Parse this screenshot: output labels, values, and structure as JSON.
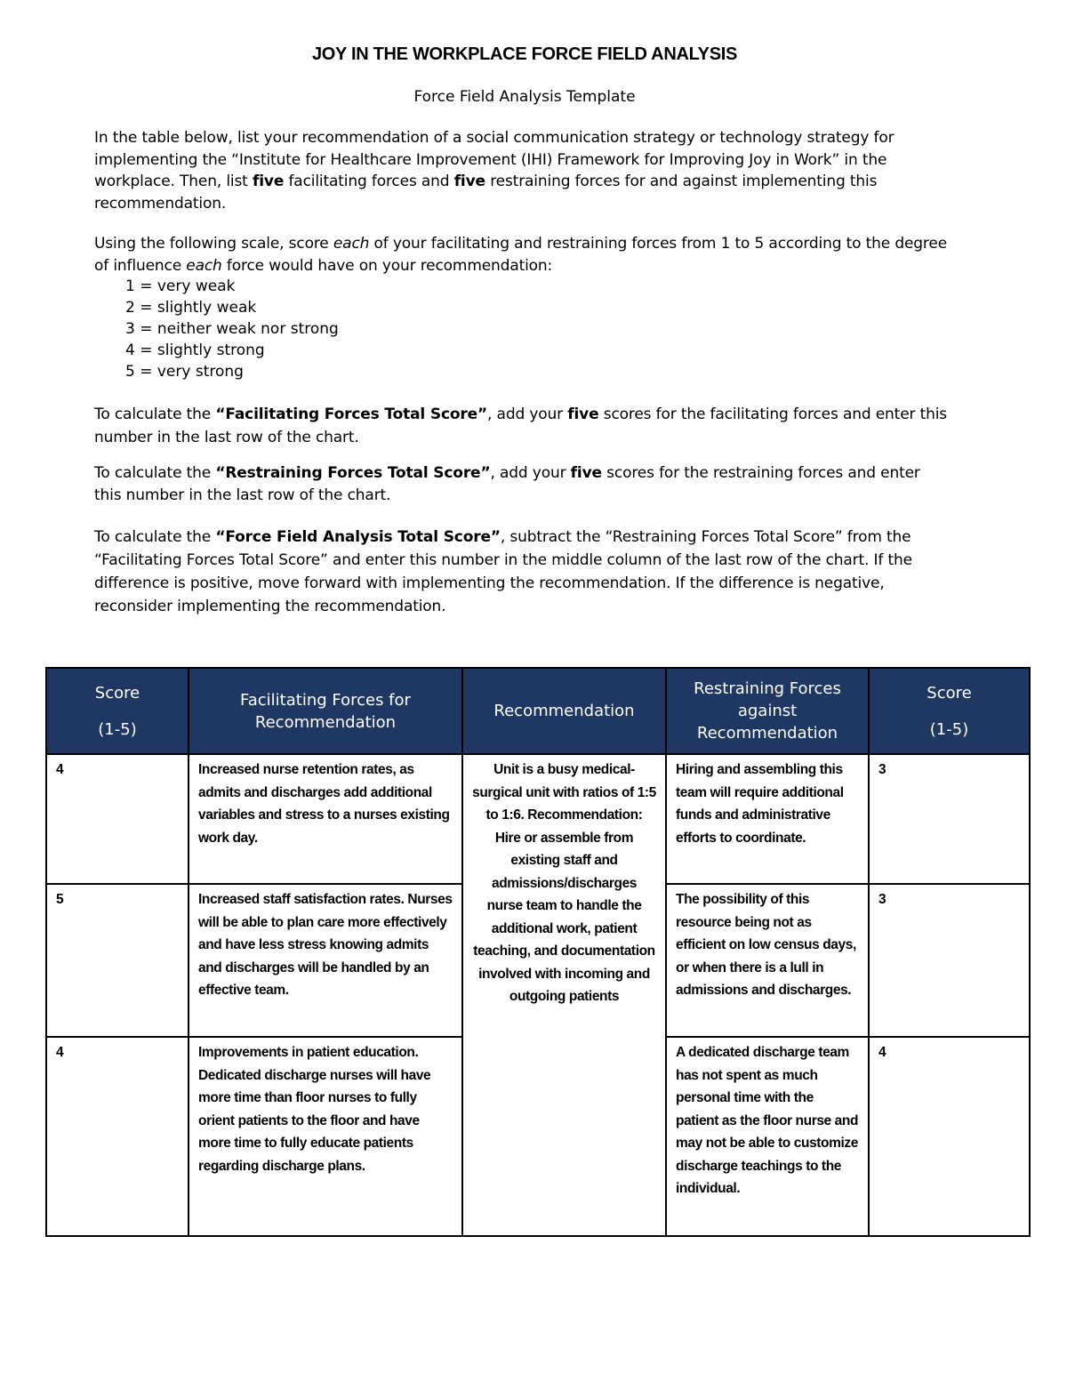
{
  "document": {
    "title": "JOY IN THE WORKPLACE FORCE FIELD ANALYSIS",
    "subtitle": "Force Field Analysis Template",
    "intro": {
      "part1": "In the table below, list your recommendation of a social communication strategy or technology strategy for implementing the “Institute for Healthcare Improvement (IHI) Framework for Improving Joy in Work” in the workplace. Then, list ",
      "bold1": "five",
      "part2": " facilitating forces and ",
      "bold2": "five",
      "part3": " restraining forces for and against implementing this recommendation."
    },
    "scale_intro": {
      "part1": "Using the following scale, score ",
      "italic1": "each",
      "part2": " of your facilitating and restraining forces from 1 to 5 according to the degree of influence ",
      "italic2": "each",
      "part3": " force would have on your recommendation:"
    },
    "scale": [
      "1 = very weak",
      "2 = slightly weak",
      "3 = neither weak nor strong",
      "4 = slightly strong",
      "5 = very strong"
    ],
    "facilitating_instructions": {
      "part1": "To calculate the ",
      "bold1": "“Facilitating Forces Total Score”",
      "part2": ",  add your ",
      "bold2": "five",
      "part3": " scores for the facilitating forces and enter this number in the last row of the chart."
    },
    "restraining_instructions": {
      "part1": "To calculate the ",
      "bold1": "“Restraining Forces Total Score”",
      "part2": ", add your ",
      "bold2": "five",
      "part3": " scores for the restraining forces and enter this number in the last row of the chart."
    },
    "total_instructions": {
      "part1": "To calculate the ",
      "bold1": "“Force Field Analysis Total Score”",
      "part2": ", subtract the “Restraining Forces Total Score” from the “Facilitating Forces Total Score” and enter this number in the middle column of the last row of the chart. If the difference is positive, move forward with implementing the recommendation. If the difference is negative, reconsider implementing the recommendation."
    }
  },
  "table": {
    "header_color": "#1f3763",
    "headers": {
      "score_left_line1": "Score",
      "score_left_line2": "(1-5)",
      "facilitating": "Facilitating Forces for Recommendation",
      "recommendation": "Recommendation",
      "restraining": "Restraining Forces against Recommendation",
      "score_right_line1": "Score",
      "score_right_line2": "(1-5)"
    },
    "recommendation": "Unit is a busy medical-surgical unit with ratios of 1:5 to 1:6. Recommendation: Hire or assemble from existing staff and admissions/discharges nurse team to handle the additional work, patient teaching, and documentation involved with incoming and outgoing patients",
    "rows": [
      {
        "facilitating_score": "4",
        "facilitating_force": "Increased nurse retention rates, as admits and discharges add additional variables and stress to a nurses existing work day.",
        "restraining_force": "Hiring and assembling this team will require additional funds and administrative efforts to coordinate.",
        "restraining_score": "3"
      },
      {
        "facilitating_score": "5",
        "facilitating_force": "Increased staff satisfaction rates. Nurses  will be able to plan care more effectively and have less stress knowing admits and discharges will be handled by an effective team.",
        "restraining_force": "The possibility of this resource being not as efficient on low census days, or when there is a lull in admissions and discharges.",
        "restraining_score": "3"
      },
      {
        "facilitating_score": "4",
        "facilitating_force": "Improvements in patient education. Dedicated discharge nurses will have more time than floor nurses to fully orient patients to the floor and have more time to fully educate patients regarding discharge plans.",
        "restraining_force": "A dedicated discharge team has not spent as much personal time with the patient as the floor nurse and may not be able to customize discharge teachings to the individual.",
        "restraining_score": "4"
      }
    ]
  }
}
